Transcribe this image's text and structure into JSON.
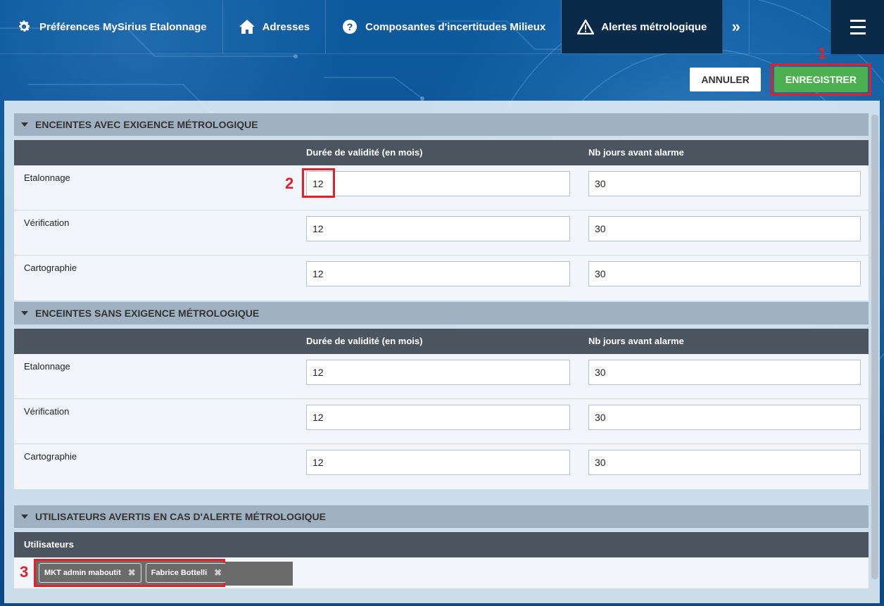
{
  "nav": {
    "tabs": [
      {
        "label": "Préférences MySirius Etalonnage",
        "icon": "gear-icon"
      },
      {
        "label": "Adresses",
        "icon": "home-icon"
      },
      {
        "label": "Composantes d'incertitudes Milieux",
        "icon": "question-circle-icon"
      },
      {
        "label": "Alertes métrologique",
        "icon": "warning-icon",
        "active": true
      }
    ],
    "more_icon": "»"
  },
  "actions": {
    "cancel_label": "ANNULER",
    "save_label": "ENREGISTRER"
  },
  "annotations": [
    "1",
    "2",
    "3"
  ],
  "sections": {
    "with_requirement": {
      "title": "ENCEINTES AVEC EXIGENCE MÉTROLOGIQUE",
      "col_validity": "Durée de validité (en mois)",
      "col_alarm": "Nb jours avant alarme",
      "rows": [
        {
          "label": "Etalonnage",
          "validity": "12",
          "alarm": "30"
        },
        {
          "label": "Vérification",
          "validity": "12",
          "alarm": "30"
        },
        {
          "label": "Cartographie",
          "validity": "12",
          "alarm": "30"
        }
      ]
    },
    "without_requirement": {
      "title": "ENCEINTES SANS EXIGENCE MÉTROLOGIQUE",
      "col_validity": "Durée de validité (en mois)",
      "col_alarm": "Nb jours avant alarme",
      "rows": [
        {
          "label": "Etalonnage",
          "validity": "12",
          "alarm": "30"
        },
        {
          "label": "Vérification",
          "validity": "12",
          "alarm": "30"
        },
        {
          "label": "Cartographie",
          "validity": "12",
          "alarm": "30"
        }
      ]
    },
    "users": {
      "title": "UTILISATEURS AVERTIS EN CAS D'ALERTE MÉTROLOGIQUE",
      "column": "Utilisateurs",
      "tags": [
        "MKT admin maboutit",
        "Fabrice Bottelli"
      ]
    }
  },
  "colors": {
    "accent_save": "#4caf50",
    "highlight": "#e0202a",
    "header_dark": "#4a5560",
    "section_bar": "#9fb2c1"
  }
}
